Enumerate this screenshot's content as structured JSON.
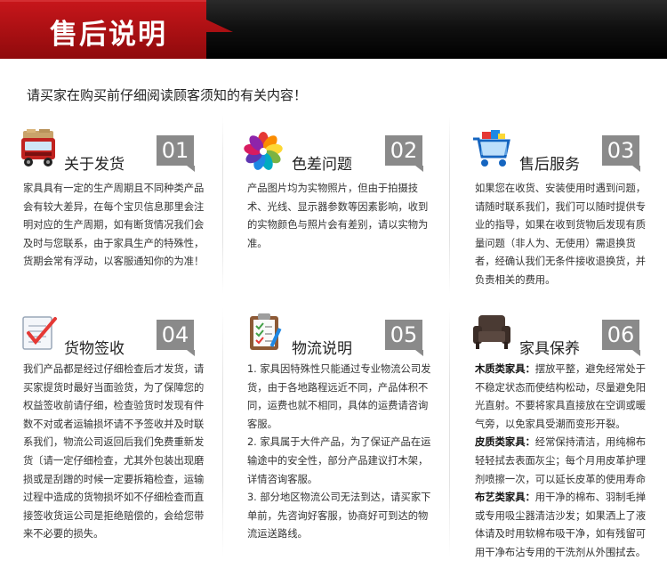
{
  "header": {
    "title": "售后说明"
  },
  "notice": "请买家在购买前仔细阅读顾客须知的有关内容！",
  "colors": {
    "accent_red": "#b00d0d",
    "badge_gray": "#8a8a8a",
    "header_black": "#0a0a0a"
  },
  "cards": [
    {
      "num": "01",
      "title": "关于发货",
      "icon": "delivery-truck-icon",
      "paragraphs": [
        "家具具有一定的生产周期且不同种类产品会有较大差异，在每个宝贝信息那里会注明对应的生产周期，如有断货情况我们会及时与您联系，由于家具生产的特殊性，货期会常有浮动，以客服通知你的为准！"
      ]
    },
    {
      "num": "02",
      "title": "色差问题",
      "icon": "color-palette-icon",
      "paragraphs": [
        "产品图片均为实物照片，但由于拍摄技术、光线、显示器参数等因素影响，收到的实物颜色与照片会有差别，请以实物为准。"
      ]
    },
    {
      "num": "03",
      "title": "售后服务",
      "icon": "shopping-cart-icon",
      "paragraphs": [
        "如果您在收货、安装使用时遇到问题，请随时联系我们，我们可以随时提供专业的指导，如果在收到货物后发现有质量问题（非人为、无使用）需退换货者，经确认我们无条件接收退换货，并负责相关的费用。"
      ]
    },
    {
      "num": "04",
      "title": "货物签收",
      "icon": "checklist-icon",
      "paragraphs": [
        "我们产品都是经过仔细检查后才发货，请买家提货时最好当面验货，为了保障您的权益签收前请仔细，检查验货时发现有件数不对或者运输损坏请不予签收并及时联系我们，物流公司返回后我们免费重新发货〔请一定仔细检查，尤其外包装出现磨损或是刮蹭的时候一定要拆箱检查，运输过程中造成的货物损坏如不仔细检查而直接签收货运公司是拒绝赔偿的，会给您带来不必要的损失。"
      ]
    },
    {
      "num": "05",
      "title": "物流说明",
      "icon": "clipboard-icon",
      "paragraphs": [
        "1. 家具因特殊性只能通过专业物流公司发货，由于各地路程远近不同，产品体积不同，运费也就不相同，具体的运费请咨询客服。",
        "2. 家具属于大件产品，为了保证产品在运输途中的安全性，部分产品建议打木架，详情咨询客服。",
        "3. 部分地区物流公司无法到达，请买家下单前，先咨询好客服，协商好可到达的物流运送路线。"
      ]
    },
    {
      "num": "06",
      "title": "家具保养",
      "icon": "armchair-icon",
      "paragraphs": [],
      "items": [
        {
          "label": "木质类家具：",
          "text": "摆放平整，避免经常处于不稳定状态而使结构松动，尽量避免阳光直射。不要将家具直接放在空调或暖气旁，以免家具受潮而变形开裂。"
        },
        {
          "label": "皮质类家具：",
          "text": "经常保持清洁，用纯棉布轻轻拭去表面灰尘；每个月用皮革护理剂喷擦一次，可以延长皮革的使用寿命"
        },
        {
          "label": "布艺类家具：",
          "text": "用干净的棉布、羽制毛掸或专用吸尘器清洁沙发；如果洒上了液体请及时用软棉布吸干净，如有残留可用干净布沾专用的干洗剂从外围拭去。"
        }
      ]
    }
  ]
}
